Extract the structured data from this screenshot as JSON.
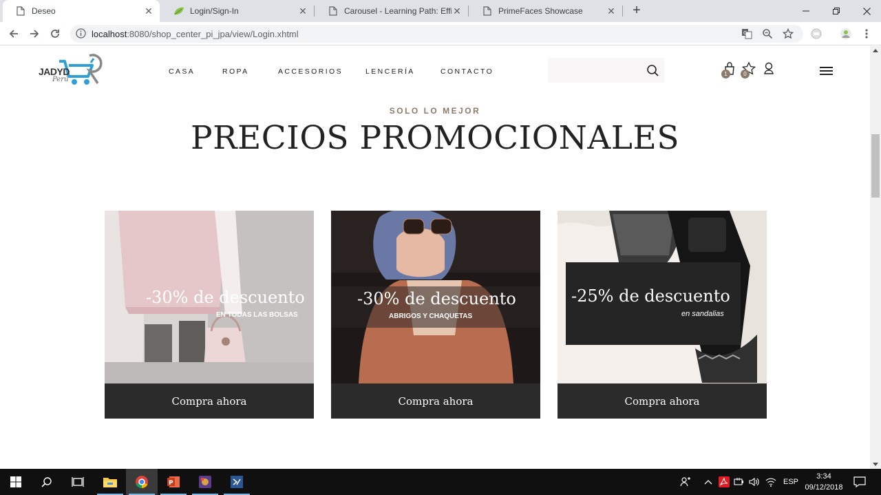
{
  "browser": {
    "tabs": [
      {
        "title": "Deseo",
        "active": true
      },
      {
        "title": "Login/Sign-In",
        "active": false
      },
      {
        "title": "Carousel - Learning Path: Efficien",
        "active": false
      },
      {
        "title": "PrimeFaces Showcase",
        "active": false
      }
    ],
    "url_host": "localhost",
    "url_path": ":8080/shop_center_pi_jpa/view/Login.xhtml"
  },
  "site": {
    "brand": "JADYD",
    "brand_sub": "Perú",
    "nav": [
      "CASA",
      "ROPA",
      "ACCESORIOS",
      "LENCERÍA",
      "CONTACTO"
    ],
    "search_placeholder": "",
    "cart_count": "1",
    "wish_count": "0"
  },
  "section": {
    "kicker": "SOLO LO MEJOR",
    "title": "PRECIOS PROMOCIONALES"
  },
  "cards": [
    {
      "discount": "-30% de descuento",
      "subtitle": "EN TODAS LAS BOLSAS",
      "button": "Compra ahora"
    },
    {
      "discount": "-30% de descuento",
      "subtitle": "ABRIGOS Y CHAQUETAS",
      "button": "Compra ahora"
    },
    {
      "discount": "-25% de descuento",
      "subtitle": "en sandalias",
      "button": "Compra ahora"
    }
  ],
  "taskbar": {
    "lang": "ESP",
    "time": "3:34",
    "date": "09/12/2018"
  },
  "colors": {
    "accent": "#8c7b6b",
    "button_bg": "#2b2b2b",
    "logo_blue": "#2f9fd8"
  }
}
